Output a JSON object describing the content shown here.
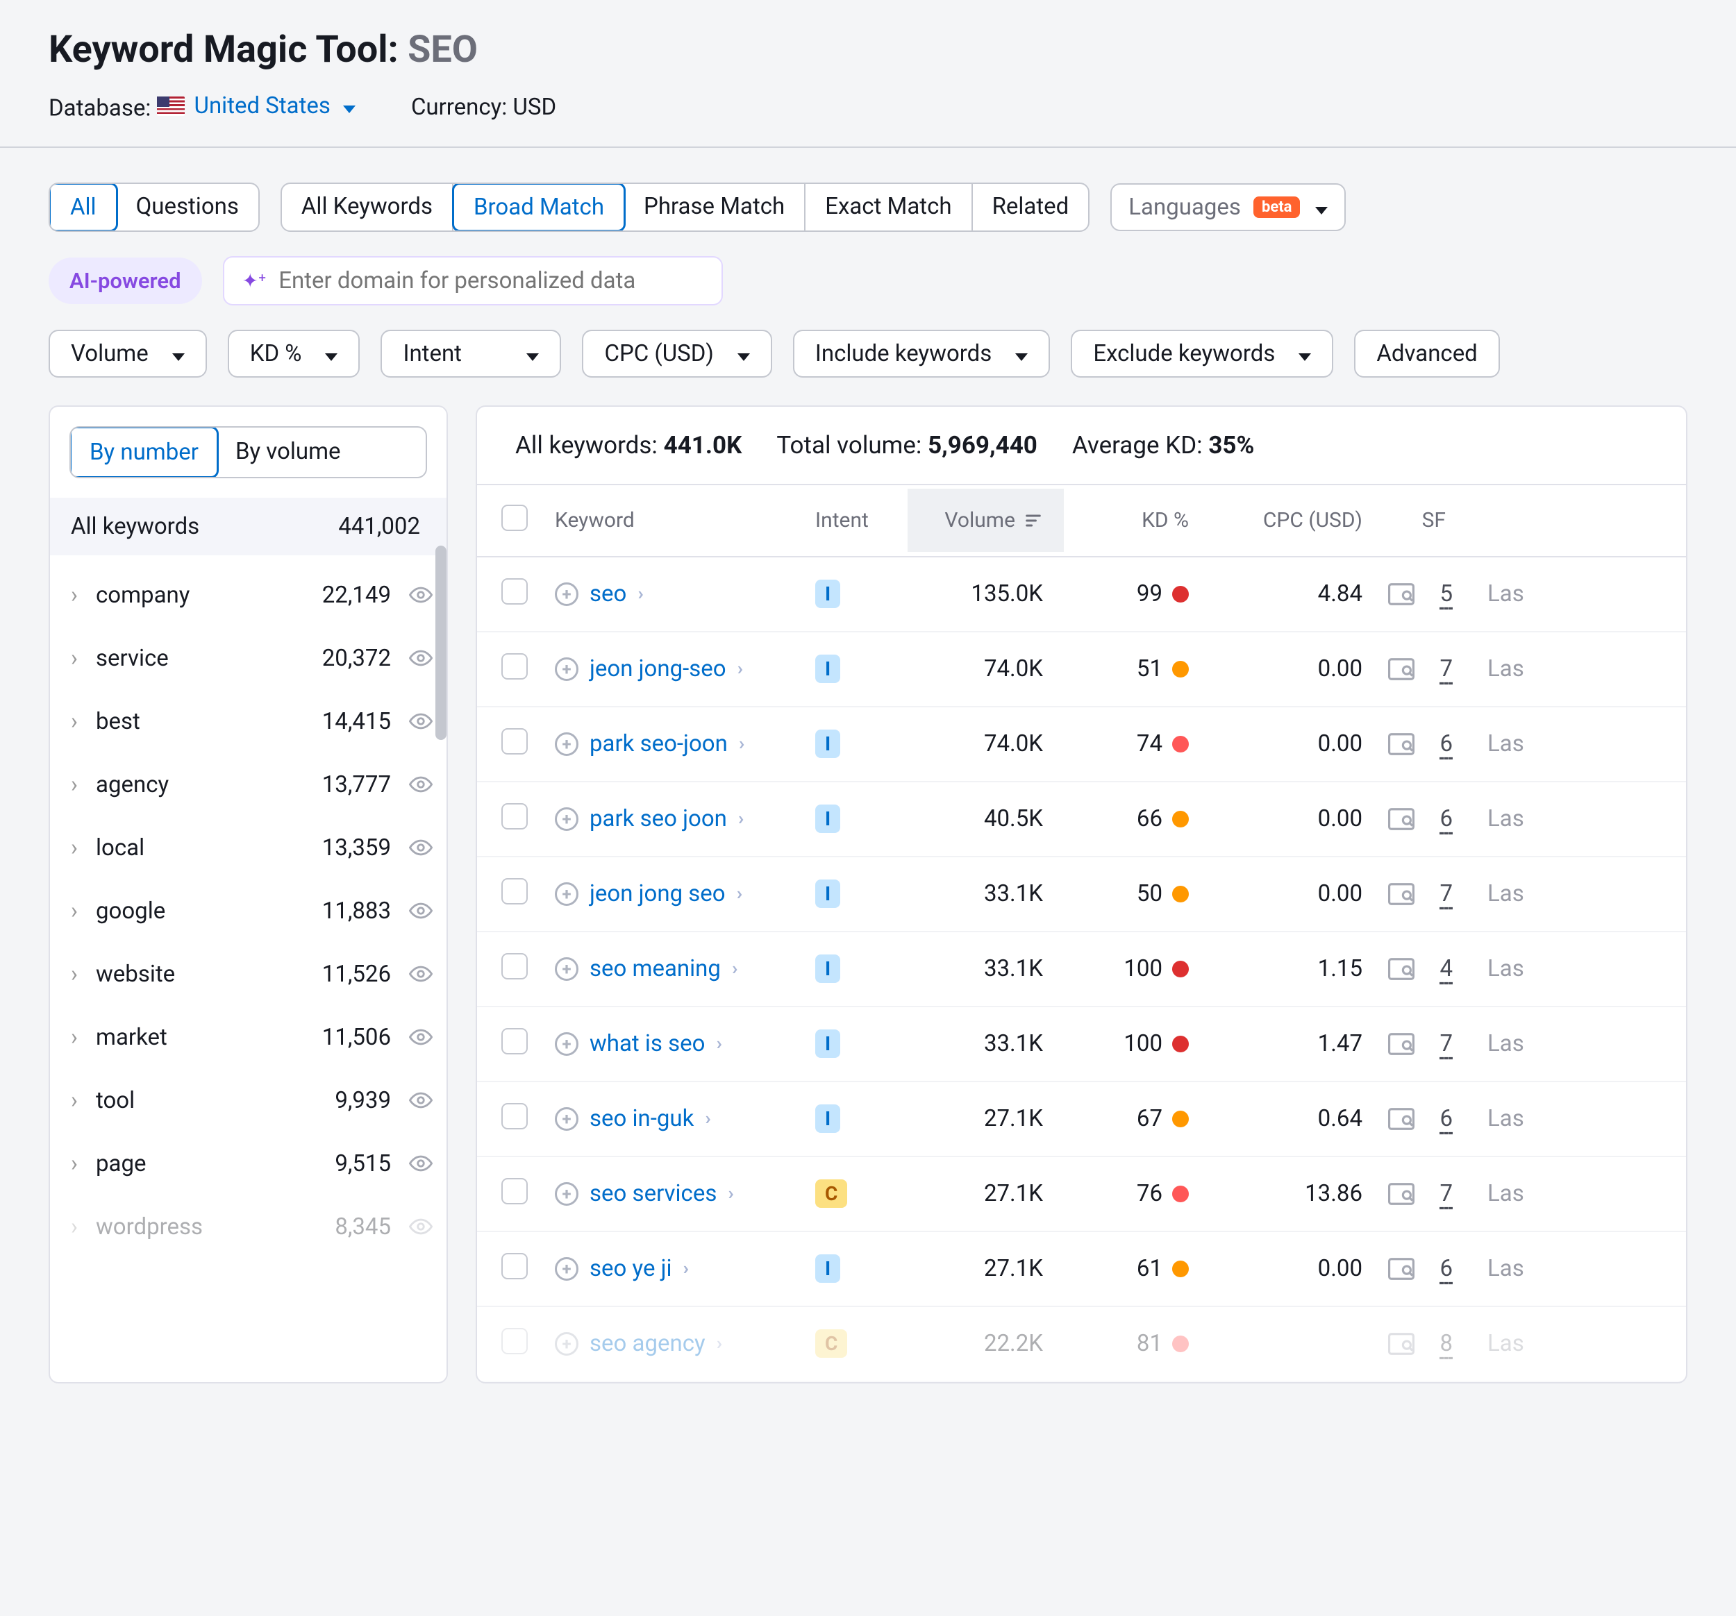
{
  "header": {
    "title": "Keyword Magic Tool:",
    "keyword": "SEO",
    "db_label": "Database:",
    "db_value": "United States",
    "currency_label": "Currency: USD"
  },
  "tabs1": {
    "all": "All",
    "questions": "Questions"
  },
  "tabs2": {
    "all_kw": "All Keywords",
    "broad": "Broad Match",
    "phrase": "Phrase Match",
    "exact": "Exact Match",
    "related": "Related"
  },
  "lang": {
    "label": "Languages",
    "beta": "beta"
  },
  "ai": {
    "pill": "AI-powered",
    "placeholder": "Enter domain for personalized data"
  },
  "drops": {
    "volume": "Volume",
    "kd": "KD %",
    "intent": "Intent",
    "cpc": "CPC (USD)",
    "include": "Include keywords",
    "exclude": "Exclude keywords",
    "adv": "Advanced"
  },
  "sidebar": {
    "by_number": "By number",
    "by_volume": "By volume",
    "all_label": "All keywords",
    "all_count": "441,002",
    "items": [
      {
        "name": "company",
        "count": "22,149"
      },
      {
        "name": "service",
        "count": "20,372"
      },
      {
        "name": "best",
        "count": "14,415"
      },
      {
        "name": "agency",
        "count": "13,777"
      },
      {
        "name": "local",
        "count": "13,359"
      },
      {
        "name": "google",
        "count": "11,883"
      },
      {
        "name": "website",
        "count": "11,526"
      },
      {
        "name": "market",
        "count": "11,506"
      },
      {
        "name": "tool",
        "count": "9,939"
      },
      {
        "name": "page",
        "count": "9,515"
      },
      {
        "name": "wordpress",
        "count": "8,345"
      }
    ]
  },
  "summary": {
    "all_kw_label": "All keywords:",
    "all_kw": "441.0K",
    "total_label": "Total volume:",
    "total": "5,969,440",
    "avg_label": "Average KD:",
    "avg": "35%"
  },
  "cols": {
    "keyword": "Keyword",
    "intent": "Intent",
    "volume": "Volume",
    "kd": "KD %",
    "cpc": "CPC (USD)",
    "sf": "SF"
  },
  "rows": [
    {
      "kw": "seo",
      "intent": "I",
      "vol": "135.0K",
      "kd": "99",
      "dot": "red",
      "cpc": "4.84",
      "sf": "5",
      "upd": "Las"
    },
    {
      "kw": "jeon jong-seo",
      "intent": "I",
      "vol": "74.0K",
      "kd": "51",
      "dot": "orange",
      "cpc": "0.00",
      "sf": "7",
      "upd": "Las"
    },
    {
      "kw": "park seo-joon",
      "intent": "I",
      "vol": "74.0K",
      "kd": "74",
      "dot": "lred",
      "cpc": "0.00",
      "sf": "6",
      "upd": "Las"
    },
    {
      "kw": "park seo joon",
      "intent": "I",
      "vol": "40.5K",
      "kd": "66",
      "dot": "orange",
      "cpc": "0.00",
      "sf": "6",
      "upd": "Las"
    },
    {
      "kw": "jeon jong seo",
      "intent": "I",
      "vol": "33.1K",
      "kd": "50",
      "dot": "orange",
      "cpc": "0.00",
      "sf": "7",
      "upd": "Las"
    },
    {
      "kw": "seo meaning",
      "intent": "I",
      "vol": "33.1K",
      "kd": "100",
      "dot": "red",
      "cpc": "1.15",
      "sf": "4",
      "upd": "Las"
    },
    {
      "kw": "what is seo",
      "intent": "I",
      "vol": "33.1K",
      "kd": "100",
      "dot": "red",
      "cpc": "1.47",
      "sf": "7",
      "upd": "Las"
    },
    {
      "kw": "seo in-guk",
      "intent": "I",
      "vol": "27.1K",
      "kd": "67",
      "dot": "orange",
      "cpc": "0.64",
      "sf": "6",
      "upd": "Las"
    },
    {
      "kw": "seo services",
      "intent": "C",
      "vol": "27.1K",
      "kd": "76",
      "dot": "lred",
      "cpc": "13.86",
      "sf": "7",
      "upd": "Las"
    },
    {
      "kw": "seo ye ji",
      "intent": "I",
      "vol": "27.1K",
      "kd": "61",
      "dot": "orange",
      "cpc": "0.00",
      "sf": "6",
      "upd": "Las"
    },
    {
      "kw": "seo agency",
      "intent": "C",
      "vol": "22.2K",
      "kd": "81",
      "dot": "lred",
      "cpc": "",
      "sf": "8",
      "upd": "Las"
    }
  ]
}
